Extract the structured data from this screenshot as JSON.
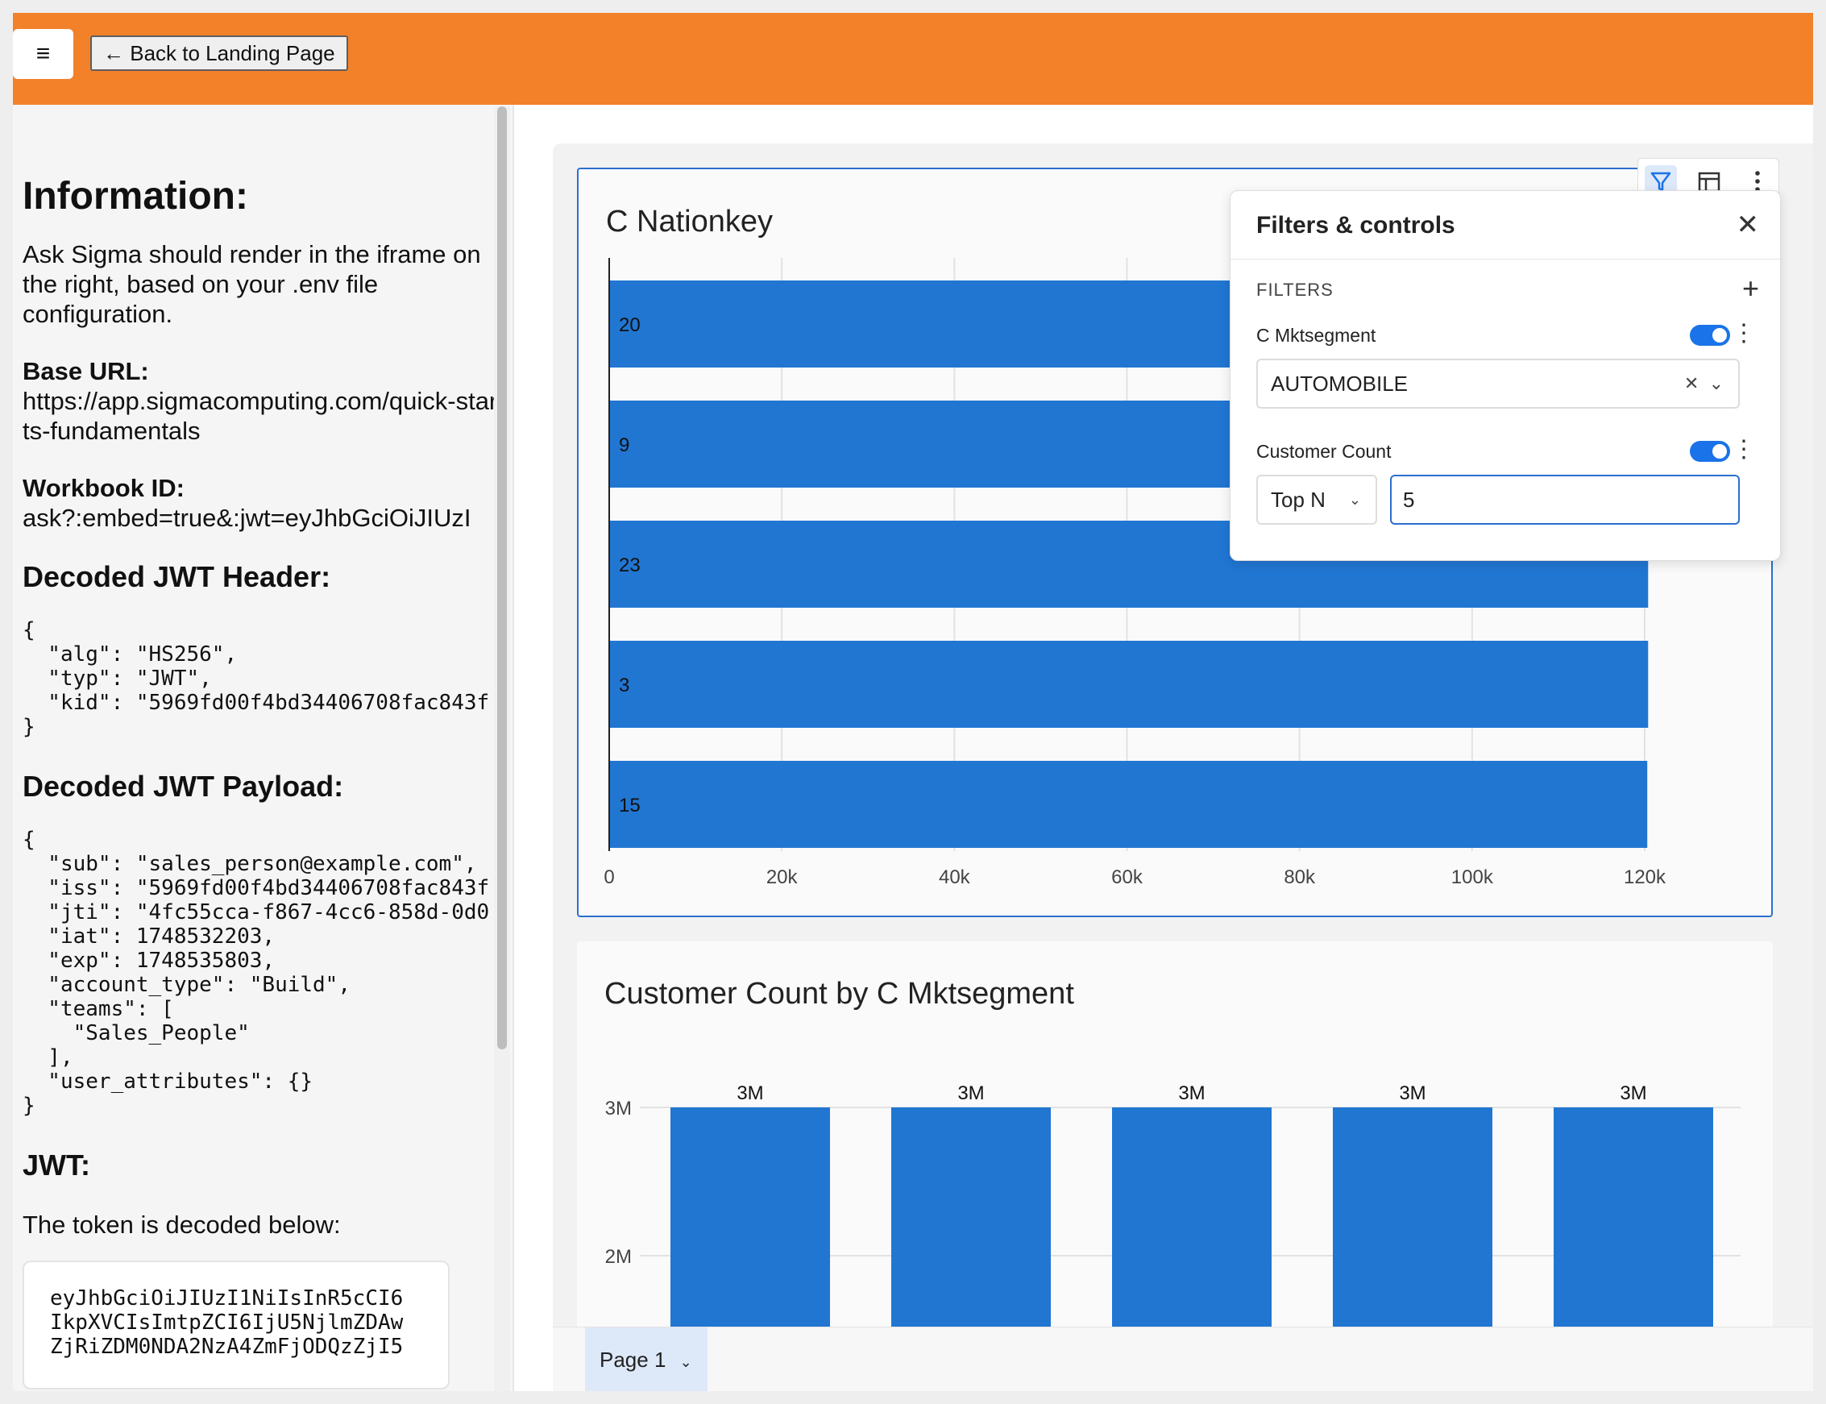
{
  "header": {
    "menu_icon": "hamburger-icon",
    "back_label": "← Back to Landing Page",
    "color": "#f3812a"
  },
  "info": {
    "title": "Information:",
    "intro": "Ask Sigma should render in the iframe on the right, based on your .env file configuration.",
    "base_url_label": "Base URL:",
    "base_url": "https://app.sigmacomputing.com/quick-starts-fundamentals",
    "workbook_label": "Workbook ID:",
    "workbook_id": "ask?:embed=true&:jwt=eyJhbGciOiJIUzI",
    "jwt_header_title": "Decoded JWT Header:",
    "jwt_header": "{\n  \"alg\": \"HS256\",\n  \"typ\": \"JWT\",\n  \"kid\": \"5969fd00f4bd34406708fac843f\n}",
    "jwt_payload_title": "Decoded JWT Payload:",
    "jwt_payload": "{\n  \"sub\": \"sales_person@example.com\",\n  \"iss\": \"5969fd00f4bd34406708fac843f\n  \"jti\": \"4fc55cca-f867-4cc6-858d-0d0\n  \"iat\": 1748532203,\n  \"exp\": 1748535803,\n  \"account_type\": \"Build\",\n  \"teams\": [\n    \"Sales_People\"\n  ],\n  \"user_attributes\": {}\n}",
    "jwt_title": "JWT:",
    "jwt_desc": "The token is decoded below:",
    "jwt_token": "eyJhbGciOiJIUzI1NiIsInR5cCI6\nIkpXVCIsImtpZCI6IjU5NjlmZDAw\nZjRiZDM0NDA2NzA4ZmFjODQzZjI5"
  },
  "toolbar": {
    "icons": [
      "filter-icon",
      "table-icon",
      "more-icon"
    ]
  },
  "filters_panel": {
    "title": "Filters & controls",
    "section": "FILTERS",
    "filter1_label": "C Mktsegment",
    "filter1_value": "AUTOMOBILE",
    "filter2_label": "Customer Count",
    "filter2_mode": "Top N",
    "filter2_value": "5",
    "accent": "#1a73e8"
  },
  "page_tab": {
    "label": "Page 1"
  },
  "chart_data": [
    {
      "type": "bar",
      "orientation": "horizontal",
      "title": "C Nationkey",
      "categories": [
        "20",
        "9",
        "23",
        "3",
        "15"
      ],
      "values": [
        120500,
        120400,
        120400,
        120400,
        120300
      ],
      "xlim": [
        0,
        120000
      ],
      "xticks": [
        "0",
        "20k",
        "40k",
        "60k",
        "80k",
        "100k",
        "120k"
      ],
      "grid": true,
      "color": "#2176d2"
    },
    {
      "type": "bar",
      "title": "Customer Count by C Mktsegment",
      "categories": [
        "",
        "",
        "",
        "",
        ""
      ],
      "values": [
        3000000,
        3000000,
        3000000,
        3000000,
        3000000
      ],
      "data_labels": [
        "3M",
        "3M",
        "3M",
        "3M",
        "3M"
      ],
      "yticks": [
        "3M",
        "2M"
      ],
      "grid": true,
      "color": "#2176d2"
    }
  ]
}
